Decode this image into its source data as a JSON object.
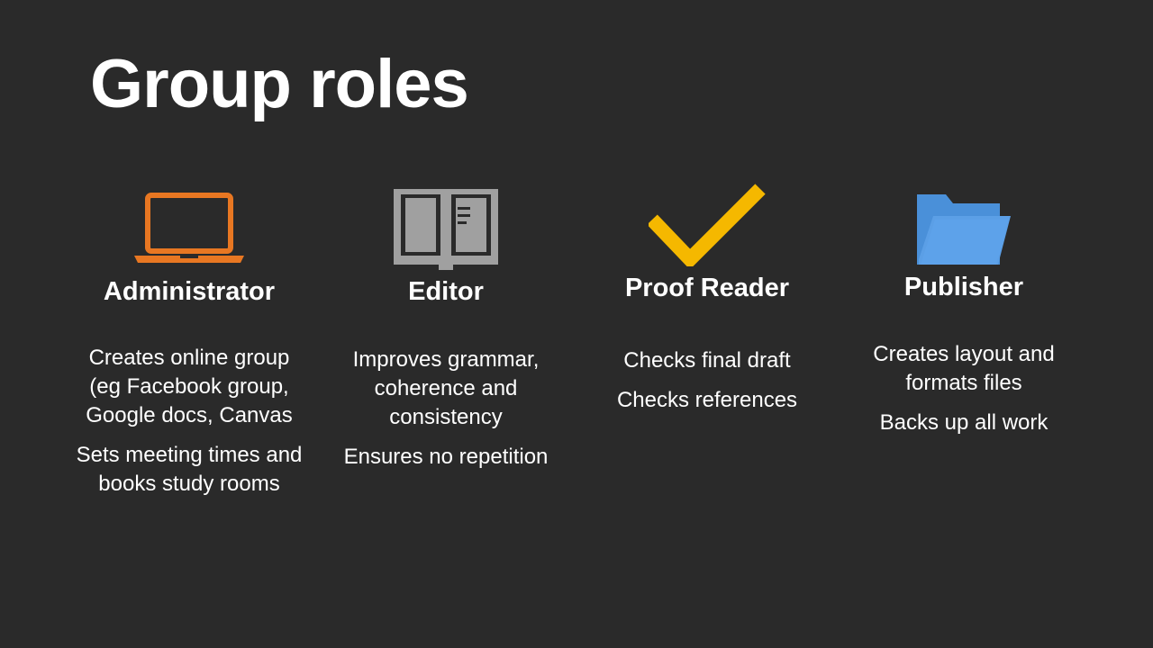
{
  "slide": {
    "title": "Group roles"
  },
  "roles": [
    {
      "name": "Administrator",
      "icon": "laptop-icon",
      "color": "#e87722",
      "paragraphs": [
        "Creates online group (eg Facebook group, Google docs, Canvas",
        "Sets meeting times and books study rooms"
      ]
    },
    {
      "name": "Editor",
      "icon": "book-icon",
      "color": "#a0a0a0",
      "paragraphs": [
        "Improves grammar, coherence and consistency",
        "Ensures no repetition"
      ]
    },
    {
      "name": "Proof Reader",
      "icon": "checkmark-icon",
      "color": "#f5b800",
      "paragraphs": [
        "Checks final draft",
        "Checks references"
      ]
    },
    {
      "name": "Publisher",
      "icon": "folder-icon",
      "color": "#4a90d9",
      "paragraphs": [
        "Creates layout and formats files",
        "Backs up all work"
      ]
    }
  ]
}
